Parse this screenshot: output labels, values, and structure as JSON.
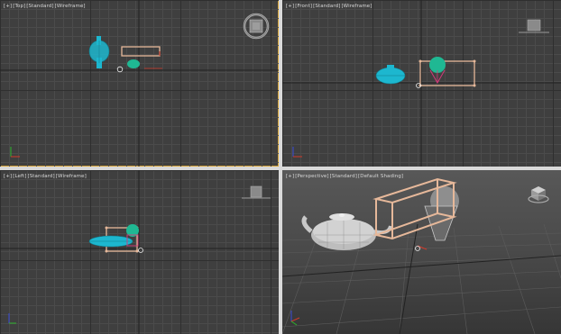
{
  "viewports": [
    {
      "id": "top",
      "labels": [
        "[+]",
        "[Top]",
        "[Standard]",
        "[Wireframe]"
      ],
      "active": true
    },
    {
      "id": "front",
      "labels": [
        "[+]",
        "[Front]",
        "[Standard]",
        "[Wireframe]"
      ],
      "active": false
    },
    {
      "id": "left",
      "labels": [
        "[+]",
        "[Left]",
        "[Standard]",
        "[Wireframe]"
      ],
      "active": false
    },
    {
      "id": "perspective",
      "labels": [
        "[+]",
        "[Perspective]",
        "[Standard]",
        "[Default Shading]"
      ],
      "active": false
    }
  ],
  "colors": {
    "viewport_bg": "#3f3f3f",
    "grid_minor": "#4b4b4b",
    "grid_major": "#2f2f2f",
    "active_border": "#d5a43b",
    "teapot_cyan": "#1db7cf",
    "sphere_green": "#1fb893",
    "box_wire": "#e6b89a",
    "axis_red": "#d23a2a",
    "axis_green": "#2cb52c",
    "axis_blue": "#3a4bd8"
  },
  "icons": [
    "viewcube-icon",
    "orbit-ring-icon",
    "gizmo-cube-icon",
    "axis-tripod-icon",
    "pivot-marker-icon"
  ]
}
